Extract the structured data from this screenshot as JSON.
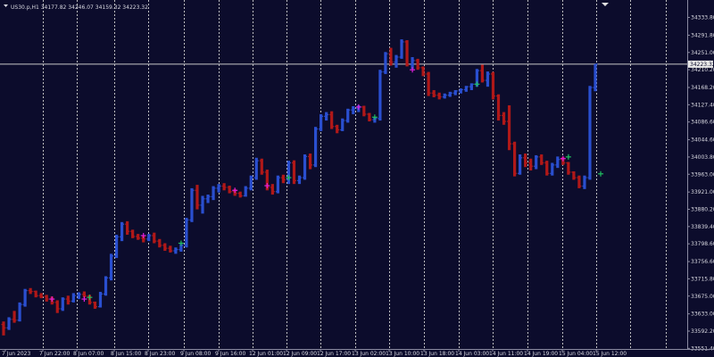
{
  "chart_data": {
    "type": "bar",
    "title": "",
    "symbol_line": "US30.p,H1  34177.82 34246.07 34159.32 34223.32",
    "xlabel": "",
    "ylabel": "",
    "ylim": [
      33550,
      34375
    ],
    "grid": true,
    "current_price_label": "34223.32",
    "current_price": 34223.32,
    "y_ticks": [
      "34333.80",
      "34291.80",
      "34251.00",
      "34210.20",
      "34168.20",
      "34127.40",
      "34086.60",
      "34044.60",
      "34003.80",
      "33963.00",
      "33921.00",
      "33880.20",
      "33839.40",
      "33798.60",
      "33756.60",
      "33715.80",
      "33675.00",
      "33633.00",
      "33592.20",
      "33551.40"
    ],
    "x_ticks": [
      "7 Jun 2023",
      "7 Jun 22:00",
      "8 Jun 07:00",
      "8 Jun 15:00",
      "8 Jun 23:00",
      "9 Jun 08:00",
      "9 Jun 16:00",
      "12 Jun 01:00",
      "12 Jun 09:00",
      "12 Jun 17:00",
      "13 Jun 02:00",
      "13 Jun 10:00",
      "13 Jun 18:00",
      "14 Jun 03:00",
      "14 Jun 11:00",
      "14 Jun 19:00",
      "15 Jun 04:00",
      "15 Jun 12:00"
    ],
    "colors": {
      "background": "#0c0c2c",
      "grid": "#dcdcdc",
      "up": "#2a4fd0",
      "down": "#b01818",
      "price_line": "#c8c8c8",
      "axis_text": "#d8d8e0",
      "marker_magenta": "#e020e0",
      "marker_green": "#20c060"
    },
    "series": [
      {
        "name": "US30.p,H1",
        "ohlc": [
          [
            33608,
            33615,
            33582,
            33600
          ],
          [
            33600,
            33625,
            33595,
            33620
          ],
          [
            33620,
            33640,
            33612,
            33618
          ],
          [
            33618,
            33660,
            33615,
            33655
          ],
          [
            33655,
            33692,
            33650,
            33688
          ],
          [
            33688,
            33694,
            33680,
            33686
          ],
          [
            33686,
            33688,
            33672,
            33676
          ],
          [
            33676,
            33682,
            33670,
            33674
          ],
          [
            33674,
            33678,
            33662,
            33668
          ],
          [
            33668,
            33674,
            33655,
            33660
          ],
          [
            33660,
            33665,
            33635,
            33645
          ],
          [
            33645,
            33672,
            33640,
            33668
          ],
          [
            33668,
            33676,
            33655,
            33663
          ],
          [
            33663,
            33682,
            33660,
            33676
          ],
          [
            33676,
            33684,
            33668,
            33679
          ],
          [
            33679,
            33686,
            33672,
            33675
          ],
          [
            33675,
            33678,
            33655,
            33660
          ],
          [
            33660,
            33662,
            33645,
            33650
          ],
          [
            33650,
            33685,
            33648,
            33680
          ],
          [
            33680,
            33722,
            33676,
            33718
          ],
          [
            33718,
            33775,
            33712,
            33770
          ],
          [
            33770,
            33820,
            33765,
            33815
          ],
          [
            33815,
            33850,
            33805,
            33845
          ],
          [
            33845,
            33852,
            33820,
            33828
          ],
          [
            33828,
            33832,
            33812,
            33816
          ],
          [
            33816,
            33822,
            33808,
            33812
          ],
          [
            33812,
            33818,
            33802,
            33810
          ],
          [
            33810,
            33822,
            33805,
            33818
          ],
          [
            33818,
            33825,
            33800,
            33805
          ],
          [
            33805,
            33810,
            33790,
            33795
          ],
          [
            33795,
            33800,
            33782,
            33788
          ],
          [
            33788,
            33794,
            33778,
            33782
          ],
          [
            33782,
            33790,
            33775,
            33785
          ],
          [
            33785,
            33798,
            33780,
            33795
          ],
          [
            33795,
            33860,
            33790,
            33855
          ],
          [
            33855,
            33930,
            33850,
            33925
          ],
          [
            33925,
            33938,
            33880,
            33890
          ],
          [
            33890,
            33912,
            33870,
            33905
          ],
          [
            33905,
            33915,
            33895,
            33910
          ],
          [
            33910,
            33935,
            33902,
            33930
          ],
          [
            33930,
            33940,
            33920,
            33935
          ],
          [
            33935,
            33942,
            33925,
            33932
          ],
          [
            33932,
            33936,
            33918,
            33922
          ],
          [
            33922,
            33928,
            33912,
            33918
          ],
          [
            33918,
            33922,
            33908,
            33912
          ],
          [
            33912,
            33935,
            33910,
            33930
          ],
          [
            33930,
            33960,
            33925,
            33955
          ],
          [
            33955,
            34002,
            33950,
            33995
          ],
          [
            33995,
            34000,
            33962,
            33968
          ],
          [
            33968,
            33974,
            33925,
            33932
          ],
          [
            33932,
            33940,
            33915,
            33922
          ],
          [
            33922,
            33960,
            33918,
            33955
          ],
          [
            33955,
            33962,
            33942,
            33950
          ],
          [
            33950,
            33995,
            33940,
            33990
          ],
          [
            33990,
            33996,
            33940,
            33948
          ],
          [
            33948,
            33960,
            33940,
            33955
          ],
          [
            33955,
            34010,
            33950,
            34005
          ],
          [
            34005,
            34012,
            33975,
            33985
          ],
          [
            33985,
            34075,
            33980,
            34070
          ],
          [
            34070,
            34105,
            34065,
            34100
          ],
          [
            34100,
            34110,
            34090,
            34104
          ],
          [
            34104,
            34112,
            34070,
            34076
          ],
          [
            34076,
            34080,
            34060,
            34068
          ],
          [
            34068,
            34095,
            34065,
            34090
          ],
          [
            34090,
            34118,
            34085,
            34115
          ],
          [
            34115,
            34124,
            34105,
            34118
          ],
          [
            34118,
            34126,
            34110,
            34122
          ],
          [
            34122,
            34125,
            34100,
            34105
          ],
          [
            34105,
            34108,
            34088,
            34092
          ],
          [
            34092,
            34098,
            34085,
            34095
          ],
          [
            34095,
            34210,
            34090,
            34205
          ],
          [
            34205,
            34252,
            34200,
            34248
          ],
          [
            34248,
            34262,
            34220,
            34228
          ],
          [
            34228,
            34245,
            34215,
            34240
          ],
          [
            34240,
            34282,
            34236,
            34276
          ],
          [
            34276,
            34280,
            34218,
            34222
          ],
          [
            34222,
            34240,
            34212,
            34232
          ],
          [
            34232,
            34236,
            34210,
            34215
          ],
          [
            34215,
            34218,
            34195,
            34200
          ],
          [
            34200,
            34205,
            34148,
            34155
          ],
          [
            34155,
            34162,
            34145,
            34150
          ],
          [
            34150,
            34156,
            34140,
            34146
          ],
          [
            34146,
            34154,
            34142,
            34150
          ],
          [
            34150,
            34158,
            34146,
            34155
          ],
          [
            34155,
            34162,
            34150,
            34160
          ],
          [
            34160,
            34166,
            34154,
            34163
          ],
          [
            34163,
            34172,
            34158,
            34170
          ],
          [
            34170,
            34178,
            34162,
            34176
          ],
          [
            34176,
            34212,
            34170,
            34208
          ],
          [
            34208,
            34222,
            34180,
            34185
          ],
          [
            34185,
            34206,
            34170,
            34200
          ],
          [
            34200,
            34205,
            34140,
            34148
          ],
          [
            34148,
            34152,
            34090,
            34102
          ],
          [
            34102,
            34110,
            34080,
            34088
          ],
          [
            34088,
            34126,
            34020,
            34035
          ],
          [
            34035,
            34040,
            33958,
            33965
          ],
          [
            33965,
            34010,
            33962,
            34002
          ],
          [
            34002,
            34012,
            33980,
            33990
          ],
          [
            33990,
            34000,
            33972,
            33982
          ],
          [
            33982,
            34008,
            33975,
            34004
          ],
          [
            34004,
            34010,
            33985,
            33990
          ],
          [
            33990,
            33995,
            33960,
            33965
          ],
          [
            33965,
            33990,
            33960,
            33985
          ],
          [
            33985,
            34005,
            33978,
            33998
          ],
          [
            33998,
            34004,
            33985,
            33990
          ],
          [
            33990,
            33992,
            33962,
            33968
          ],
          [
            33968,
            33970,
            33950,
            33955
          ],
          [
            33955,
            33960,
            33930,
            33935
          ],
          [
            33935,
            33960,
            33928,
            33955
          ],
          [
            33955,
            34172,
            33950,
            34168
          ],
          [
            34168,
            34223.32,
            34159.32,
            34223.32
          ]
        ]
      }
    ],
    "markers": [
      {
        "bar": 9,
        "price": 33668,
        "kind": "magenta"
      },
      {
        "bar": 15,
        "price": 33668,
        "kind": "magenta"
      },
      {
        "bar": 16,
        "price": 33672,
        "kind": "green"
      },
      {
        "bar": 26,
        "price": 33818,
        "kind": "magenta"
      },
      {
        "bar": 33,
        "price": 33800,
        "kind": "green"
      },
      {
        "bar": 43,
        "price": 33925,
        "kind": "magenta"
      },
      {
        "bar": 49,
        "price": 33936,
        "kind": "magenta"
      },
      {
        "bar": 53,
        "price": 33955,
        "kind": "green"
      },
      {
        "bar": 66,
        "price": 34122,
        "kind": "magenta"
      },
      {
        "bar": 69,
        "price": 34098,
        "kind": "green"
      },
      {
        "bar": 76,
        "price": 34210,
        "kind": "magenta"
      },
      {
        "bar": 88,
        "price": 34176,
        "kind": "green"
      },
      {
        "bar": 104,
        "price": 34000,
        "kind": "magenta"
      },
      {
        "bar": 105,
        "price": 34004,
        "kind": "green"
      },
      {
        "bar": 111,
        "price": 33964,
        "kind": "green"
      }
    ]
  }
}
